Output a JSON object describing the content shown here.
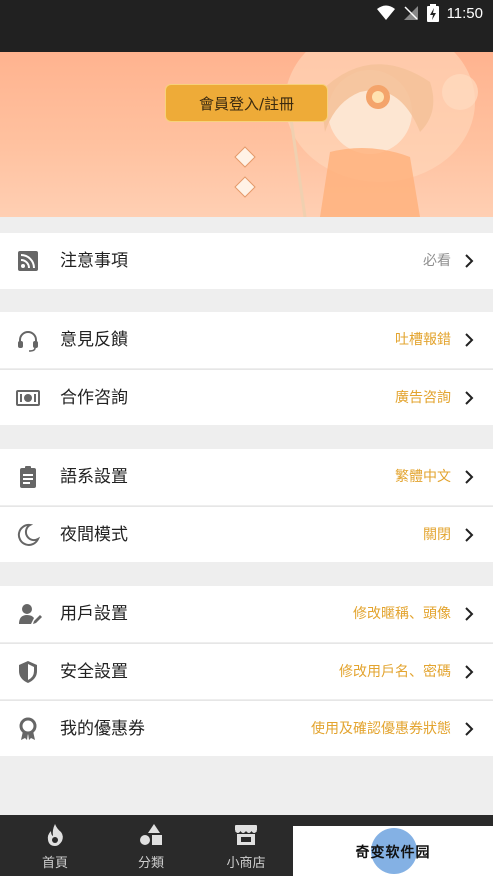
{
  "status_bar": {
    "time": "11:50"
  },
  "hero": {
    "login_button": "會員登入/註冊"
  },
  "menu": {
    "notice": {
      "label": "注意事項",
      "value": "必看"
    },
    "feedback": {
      "label": "意見反饋",
      "value": "吐槽報錯"
    },
    "cooperation": {
      "label": "合作咨詢",
      "value": "廣告咨詢"
    },
    "language": {
      "label": "語系設置",
      "value": "繁體中文"
    },
    "night_mode": {
      "label": "夜間模式",
      "value": "關閉"
    },
    "user_settings": {
      "label": "用戶設置",
      "value": "修改暱稱、頭像"
    },
    "security": {
      "label": "安全設置",
      "value": "修改用戶名、密碼"
    },
    "coupons": {
      "label": "我的優惠券",
      "value": "使用及確認優惠券狀態"
    }
  },
  "bottom_nav": {
    "home": "首頁",
    "category": "分類",
    "shop": "小商店"
  },
  "watermark": {
    "text": "奇变软件园"
  },
  "colors": {
    "accent": "#eeab38",
    "value_orange": "#e3a42f",
    "hero_bg": "#ffb38f"
  }
}
